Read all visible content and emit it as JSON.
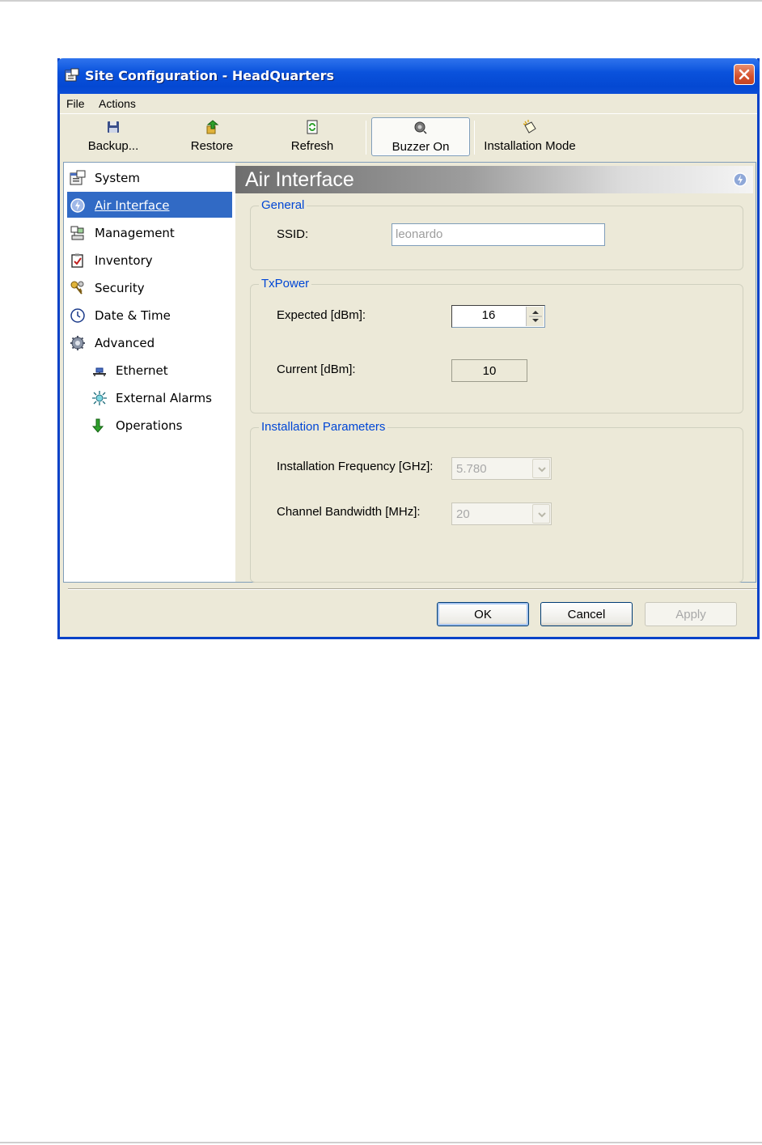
{
  "window": {
    "title": "Site Configuration - HeadQuarters"
  },
  "menu": {
    "items": [
      "File",
      "Actions"
    ]
  },
  "toolbar": {
    "backup_label": "Backup...",
    "restore_label": "Restore",
    "refresh_label": "Refresh",
    "buzzer_label": "Buzzer On",
    "installation_label": "Installation Mode"
  },
  "nav": {
    "items": [
      {
        "label": "System",
        "icon": "system-properties-icon"
      },
      {
        "label": "Air Interface",
        "icon": "air-interface-icon",
        "selected": true
      },
      {
        "label": "Management",
        "icon": "management-icon"
      },
      {
        "label": "Inventory",
        "icon": "inventory-icon"
      },
      {
        "label": "Security",
        "icon": "security-keys-icon"
      },
      {
        "label": "Date & Time",
        "icon": "clock-icon"
      },
      {
        "label": "Advanced",
        "icon": "gear-icon"
      },
      {
        "label": "Ethernet",
        "icon": "ethernet-icon"
      },
      {
        "label": "External Alarms",
        "icon": "alarm-icon"
      },
      {
        "label": "Operations",
        "icon": "down-arrow-icon"
      }
    ]
  },
  "panel": {
    "title": "Air Interface",
    "general": {
      "title": "General",
      "ssid_label": "SSID:",
      "ssid_value": "leonardo"
    },
    "txpower": {
      "title": "TxPower",
      "expected_label": "Expected [dBm]:",
      "expected_value": "16",
      "current_label": "Current [dBm]:",
      "current_value": "10"
    },
    "installation": {
      "title": "Installation Parameters",
      "frequency_label": "Installation Frequency [GHz]:",
      "frequency_value": "5.780",
      "bandwidth_label": "Channel Bandwidth [MHz]:",
      "bandwidth_value": "20"
    }
  },
  "buttons": {
    "ok": "OK",
    "cancel": "Cancel",
    "apply": "Apply"
  },
  "colors": {
    "titlebar": "#0a52dc",
    "selection": "#316ac5",
    "group_title": "#0046d5"
  }
}
